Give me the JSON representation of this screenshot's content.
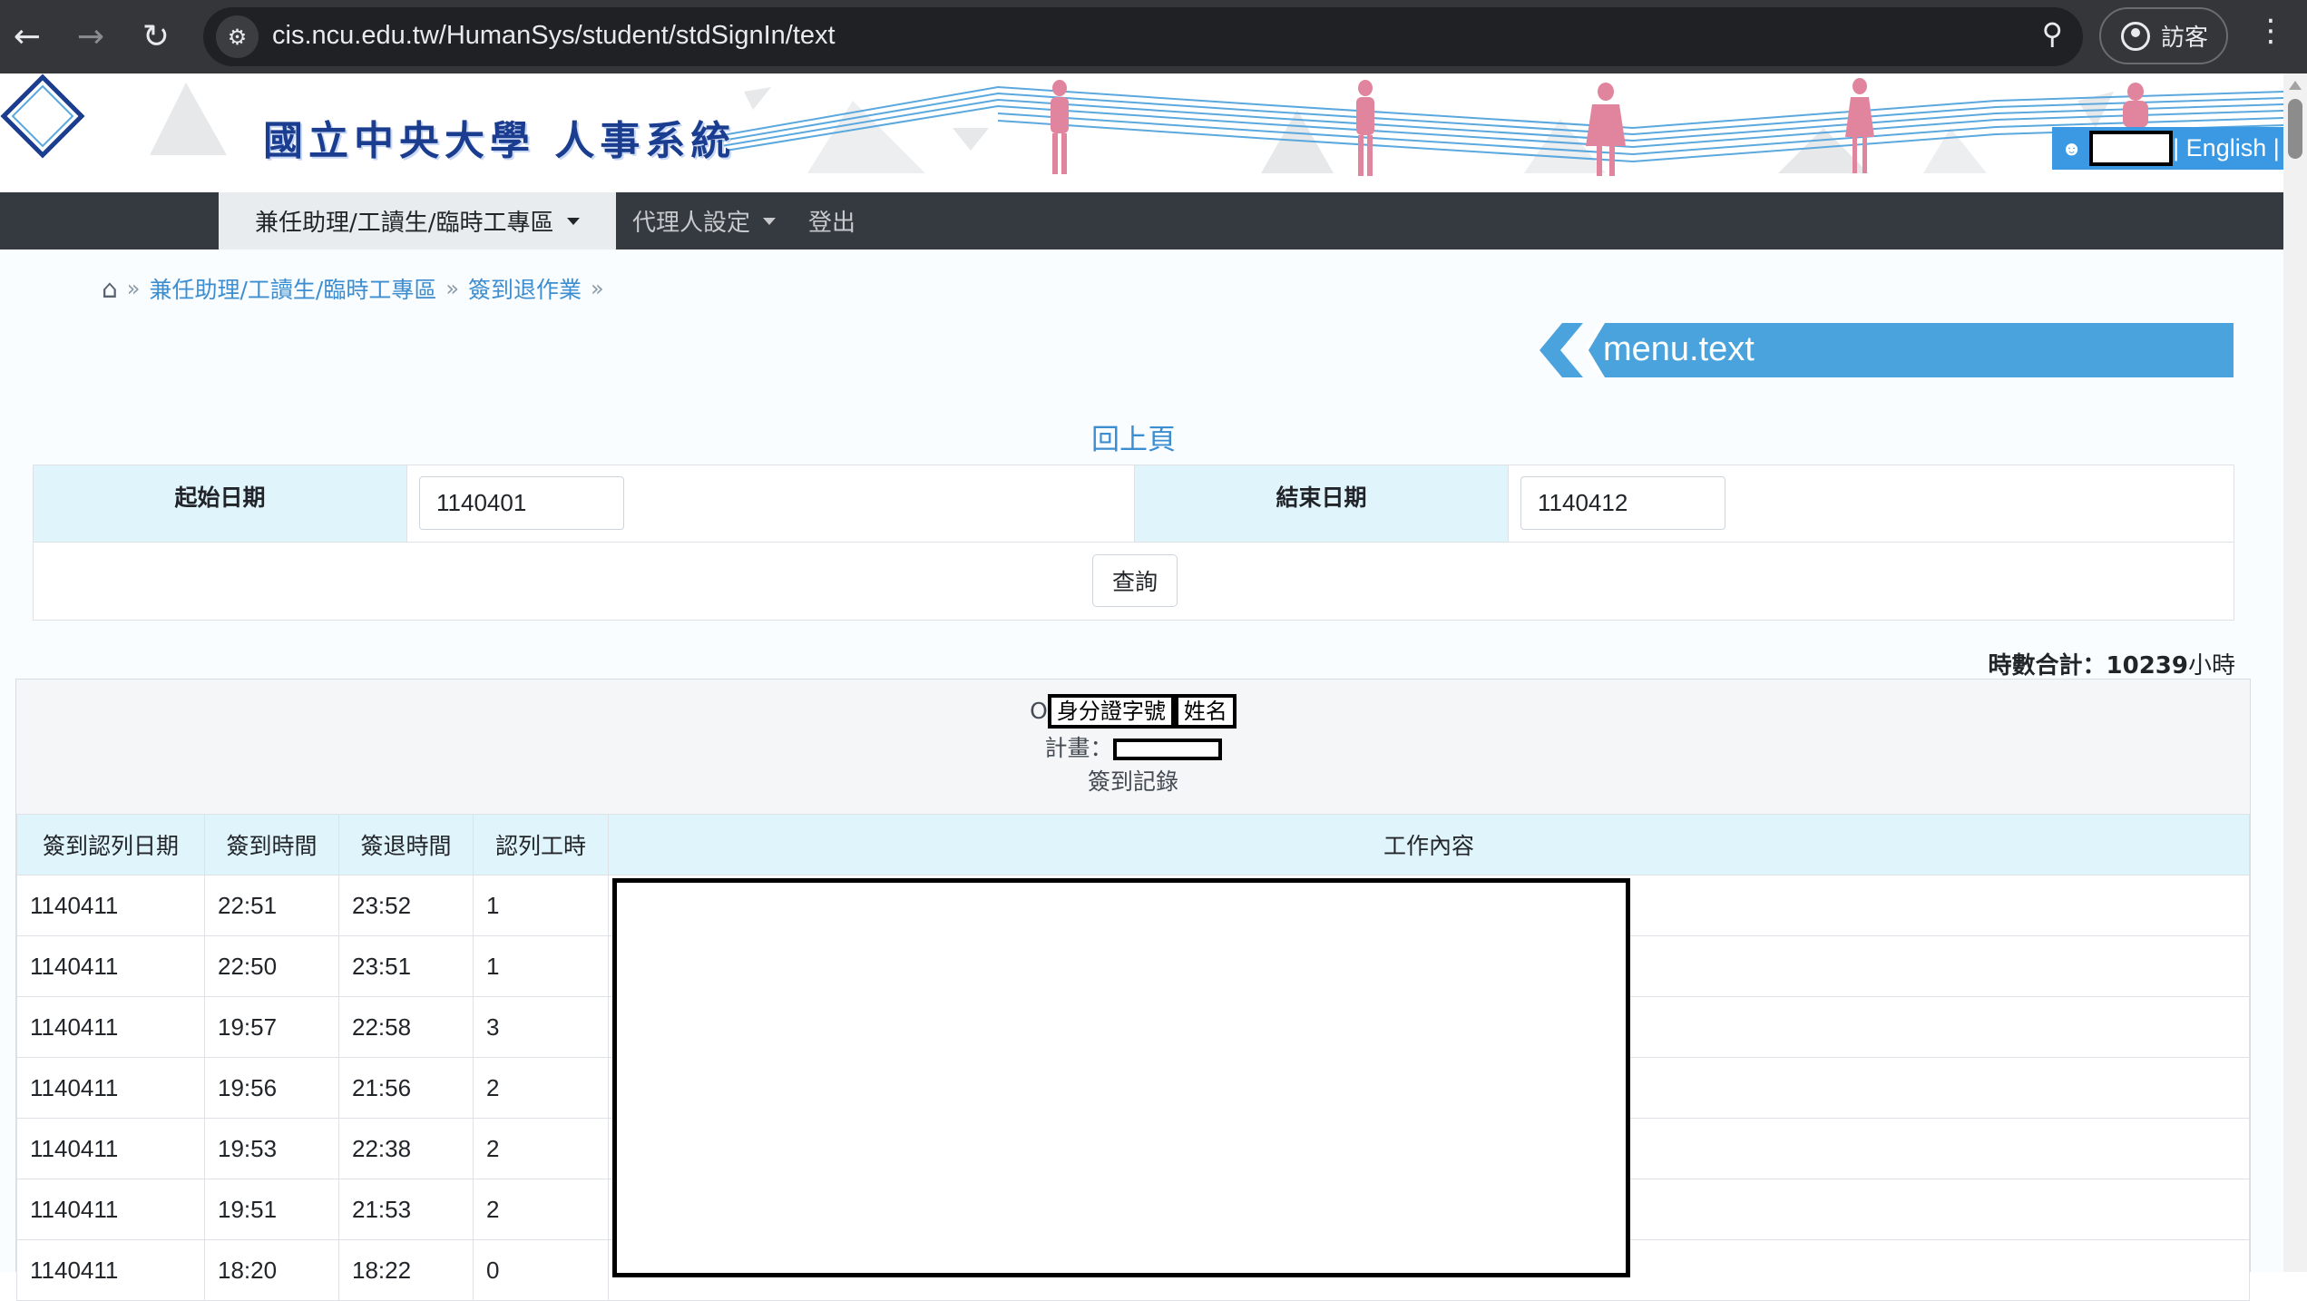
{
  "browser": {
    "url": "cis.ncu.edu.tw/HumanSys/student/stdSignIn/text",
    "profile_label": "訪客"
  },
  "banner": {
    "logo_text": "國立中央大學 人事系統",
    "language_link": "| English |"
  },
  "topnav": {
    "items": [
      {
        "label": "兼任助理/工讀生/臨時工專區"
      },
      {
        "label": "代理人設定"
      },
      {
        "label": "登出"
      }
    ]
  },
  "breadcrumb": {
    "items": [
      "兼任助理/工讀生/臨時工專區",
      "簽到退作業"
    ]
  },
  "menu_banner": "menu.text",
  "back_link": "回上頁",
  "query": {
    "start_label": "起始日期",
    "start_value": "1140401",
    "end_label": "結束日期",
    "end_value": "1140412",
    "button": "查詢"
  },
  "summary": {
    "label": "時數合計：",
    "value": "10239",
    "unit": "小時"
  },
  "record_header": {
    "prefix": "O",
    "id_label": "身分證字號",
    "name_label": "姓名",
    "plan_label": "計畫：",
    "title": "簽到記錄"
  },
  "table": {
    "columns": [
      "簽到認列日期",
      "簽到時間",
      "簽退時間",
      "認列工時",
      "工作內容"
    ],
    "rows": [
      [
        "1140411",
        "22:51",
        "23:52",
        "1"
      ],
      [
        "1140411",
        "22:50",
        "23:51",
        "1"
      ],
      [
        "1140411",
        "19:57",
        "22:58",
        "3"
      ],
      [
        "1140411",
        "19:56",
        "21:56",
        "2"
      ],
      [
        "1140411",
        "19:53",
        "22:38",
        "2"
      ],
      [
        "1140411",
        "19:51",
        "21:53",
        "2"
      ],
      [
        "1140411",
        "18:20",
        "18:22",
        "0"
      ]
    ]
  },
  "colors": {
    "header_cell_bg": "#e0f4fb",
    "link_blue": "#3d8ed0",
    "nav_bg": "#343a40",
    "menu_banner_blue": "#4aa3dc"
  }
}
